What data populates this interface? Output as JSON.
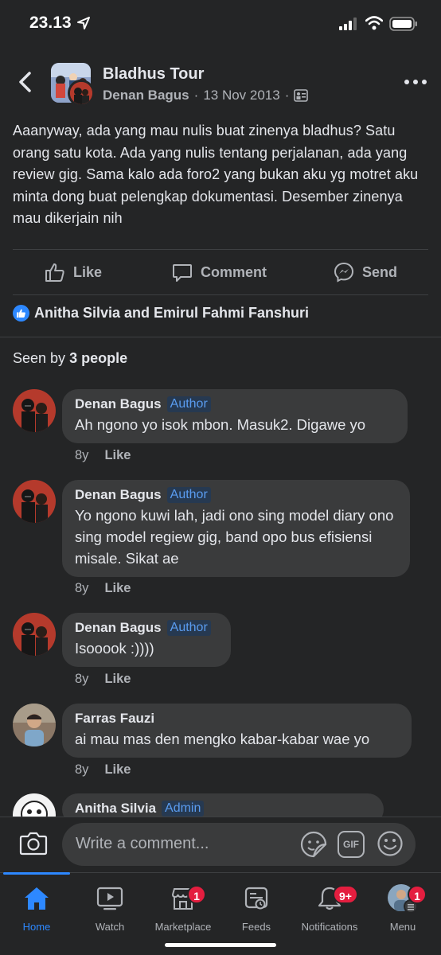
{
  "status": {
    "time": "23.13"
  },
  "post": {
    "group_name": "Bladhus Tour",
    "author": "Denan Bagus",
    "date": "13 Nov 2013",
    "separator": "·",
    "text": "Aaanyway, ada yang mau nulis buat zinenya bladhus? Satu orang satu kota. Ada yang nulis tentang perjalanan, ada yang review gig. Sama kalo ada foro2 yang bukan aku yg motret aku minta dong buat pelengkap dokumentasi. Desember zinenya mau dikerjain nih"
  },
  "actions": {
    "like": "Like",
    "comment": "Comment",
    "send": "Send"
  },
  "reactions": {
    "names": "Anitha Silvia and Emirul Fahmi Fanshuri"
  },
  "seen": {
    "prefix": "Seen by",
    "count": "3 people"
  },
  "comments": [
    {
      "name": "Denan Bagus",
      "badge": "Author",
      "text": "Ah ngono yo isok mbon. Masuk2. Digawe yo",
      "age": "8y",
      "like": "Like"
    },
    {
      "name": "Denan Bagus",
      "badge": "Author",
      "text": "Yo ngono kuwi lah, jadi ono sing model diary ono sing model regiew gig, band opo bus efisiensi misale. Sikat ae",
      "age": "8y",
      "like": "Like"
    },
    {
      "name": "Denan Bagus",
      "badge": "Author",
      "text": "Isooook :))))",
      "age": "8y",
      "like": "Like"
    },
    {
      "name": "Farras Fauzi",
      "badge": "",
      "text": "ai mau mas den mengko kabar-kabar wae yo",
      "age": "8y",
      "like": "Like"
    },
    {
      "name": "Anitha Silvia",
      "badge": "Admin",
      "text": "",
      "age": "",
      "like": ""
    }
  ],
  "composer": {
    "placeholder": "Write a comment...",
    "gif": "GIF"
  },
  "tabs": [
    {
      "label": "Home",
      "badge": ""
    },
    {
      "label": "Watch",
      "badge": ""
    },
    {
      "label": "Marketplace",
      "badge": "1"
    },
    {
      "label": "Feeds",
      "badge": ""
    },
    {
      "label": "Notifications",
      "badge": "9+"
    },
    {
      "label": "Menu",
      "badge": "1"
    }
  ],
  "colors": {
    "accent": "#2d88ff",
    "background": "#242526",
    "bubble": "#3a3b3c",
    "badge": "#e41e3f"
  }
}
